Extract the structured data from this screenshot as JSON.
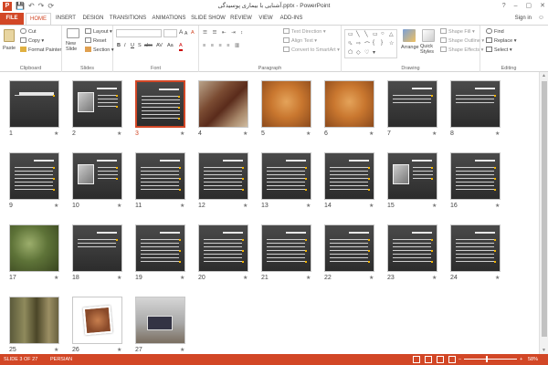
{
  "window": {
    "title": "آشنایی با بیماری پوسیدگی.pptx - PowerPoint",
    "app_icon": "P",
    "controls": [
      "?",
      "–",
      "▢",
      "✕"
    ]
  },
  "qat": [
    "💾",
    "↶",
    "↷",
    "⟳"
  ],
  "tabs": [
    {
      "label": "FILE"
    },
    {
      "label": "HOME"
    },
    {
      "label": "INSERT"
    },
    {
      "label": "DESIGN"
    },
    {
      "label": "TRANSITIONS"
    },
    {
      "label": "ANIMATIONS"
    },
    {
      "label": "SLIDE SHOW"
    },
    {
      "label": "REVIEW"
    },
    {
      "label": "VIEW"
    },
    {
      "label": "ADD-INS"
    }
  ],
  "signin": "Sign in",
  "ribbon": {
    "clipboard": {
      "paste": "Paste",
      "cut": "Cut",
      "copy": "Copy",
      "format_painter": "Format Painter",
      "label": "Clipboard"
    },
    "slides": {
      "new_slide": "New Slide",
      "layout": "Layout",
      "reset": "Reset",
      "section": "Section",
      "label": "Slides"
    },
    "font": {
      "label": "Font",
      "aa_big": "A",
      "aa_small": "A",
      "clear": "A",
      "bold": "B",
      "italic": "I",
      "underline": "U",
      "shadow": "S",
      "strike": "abc",
      "spacing": "AV",
      "case": "Aa",
      "color": "A"
    },
    "paragraph": {
      "text_direction": "Text Direction",
      "align_text": "Align Text",
      "convert_smartart": "Convert to SmartArt",
      "label": "Paragraph"
    },
    "drawing": {
      "arrange": "Arrange",
      "quick_styles": "Quick Styles",
      "shape_fill": "Shape Fill",
      "shape_outline": "Shape Outline",
      "shape_effects": "Shape Effects",
      "label": "Drawing"
    },
    "editing": {
      "find": "Find",
      "replace": "Replace",
      "select": "Select",
      "label": "Editing"
    }
  },
  "slides": [
    {
      "n": "1",
      "style": "title"
    },
    {
      "n": "2",
      "style": "mixed"
    },
    {
      "n": "3",
      "style": "text",
      "selected": true
    },
    {
      "n": "4",
      "style": "photo-branch"
    },
    {
      "n": "5",
      "style": "photo-wood"
    },
    {
      "n": "6",
      "style": "photo-wood"
    },
    {
      "n": "7",
      "style": "text-short"
    },
    {
      "n": "8",
      "style": "text-short"
    },
    {
      "n": "9",
      "style": "text"
    },
    {
      "n": "10",
      "style": "mixed"
    },
    {
      "n": "11",
      "style": "text"
    },
    {
      "n": "12",
      "style": "text"
    },
    {
      "n": "13",
      "style": "text"
    },
    {
      "n": "14",
      "style": "text"
    },
    {
      "n": "15",
      "style": "mixed"
    },
    {
      "n": "16",
      "style": "text"
    },
    {
      "n": "17",
      "style": "photo-leaf"
    },
    {
      "n": "18",
      "style": "text-short"
    },
    {
      "n": "19",
      "style": "text"
    },
    {
      "n": "20",
      "style": "text"
    },
    {
      "n": "21",
      "style": "text"
    },
    {
      "n": "22",
      "style": "text"
    },
    {
      "n": "23",
      "style": "text"
    },
    {
      "n": "24",
      "style": "text"
    },
    {
      "n": "25",
      "style": "photo-trunk"
    },
    {
      "n": "26",
      "style": "white"
    },
    {
      "n": "27",
      "style": "photo-laptop"
    }
  ],
  "status": {
    "slide_info": "SLIDE 3 OF 27",
    "language": "PERSIAN",
    "zoom_minus": "–",
    "zoom_plus": "+",
    "zoom_pct": "58%"
  },
  "colors": {
    "accent": "#d24726"
  }
}
